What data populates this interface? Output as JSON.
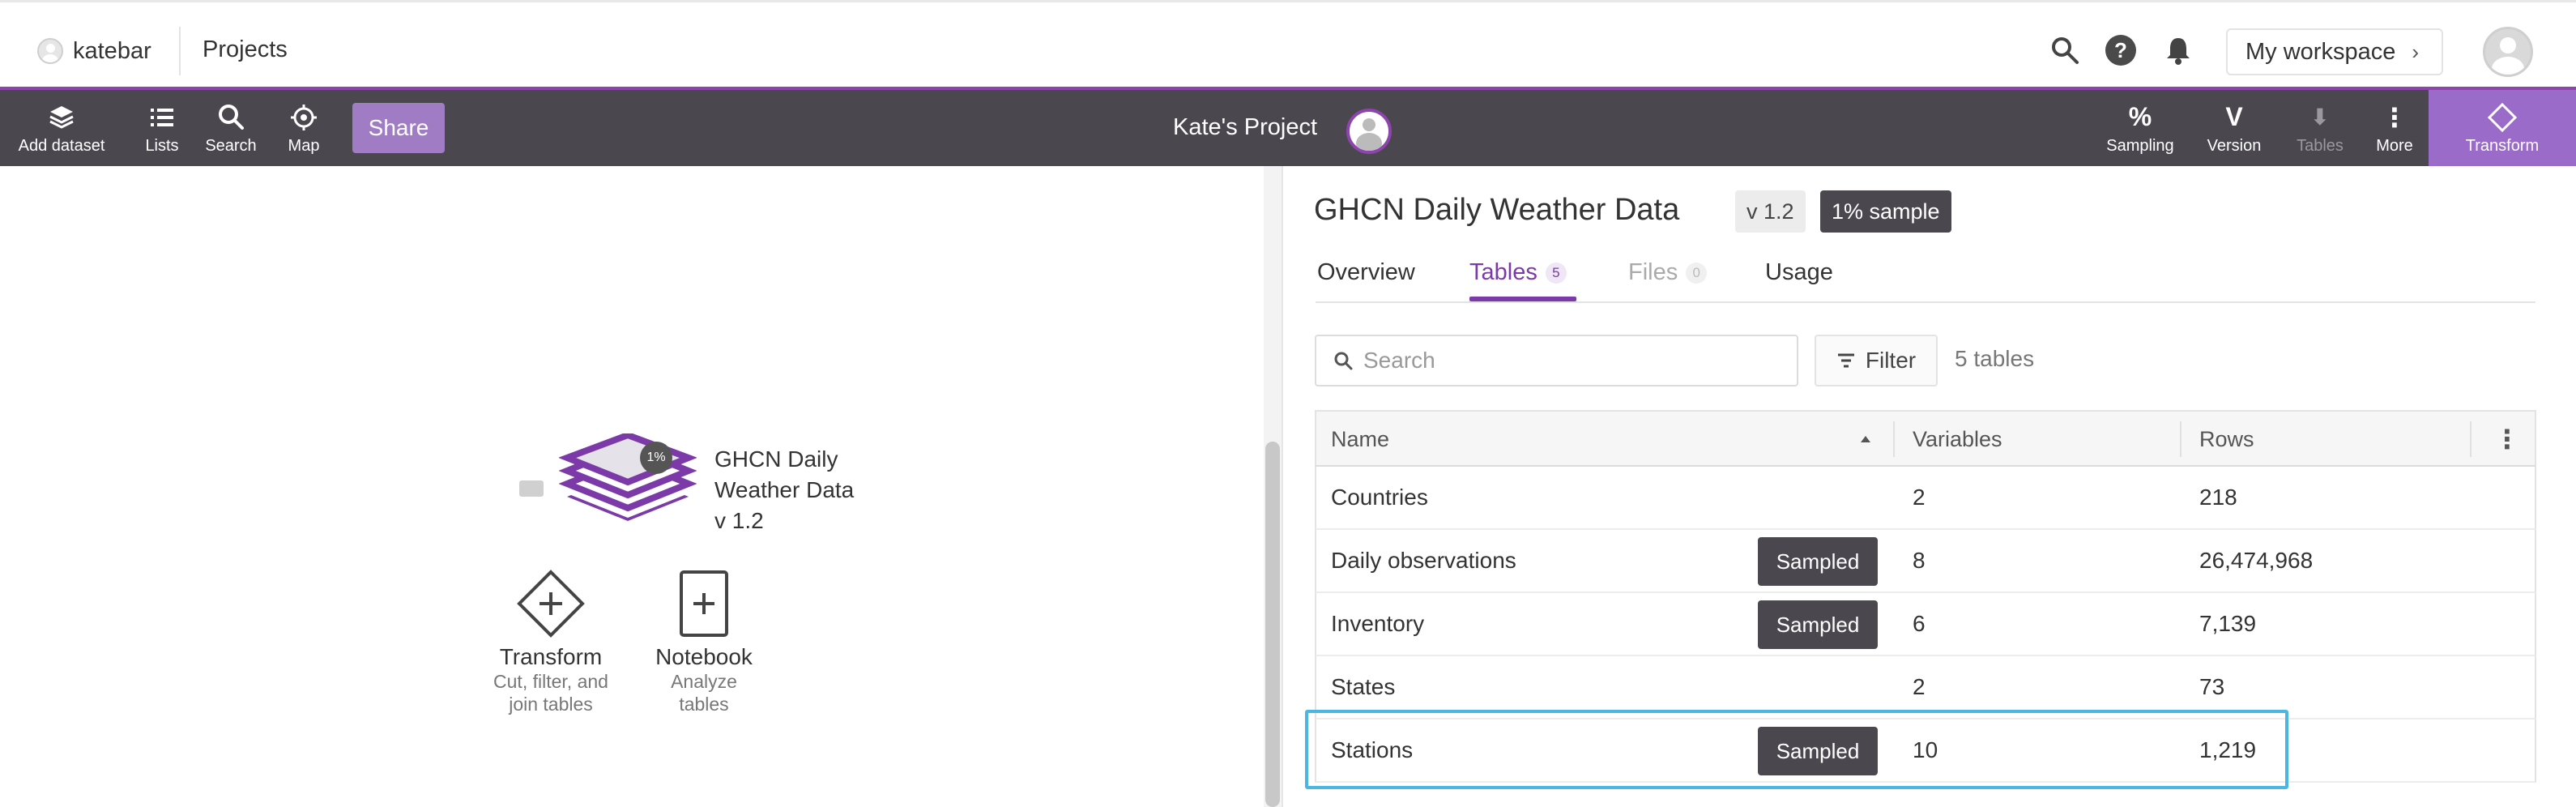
{
  "topbar": {
    "username": "katebar",
    "projects_link": "Projects",
    "workspace_button": "My workspace",
    "help_icon": "?",
    "icons": [
      "search-icon",
      "help-icon",
      "bell-icon",
      "profile-avatar"
    ]
  },
  "toolbar": {
    "left_tools": [
      {
        "label": "Add dataset",
        "icon": "layers-icon"
      },
      {
        "label": "Lists",
        "icon": "list-icon"
      },
      {
        "label": "Search",
        "icon": "search-icon"
      },
      {
        "label": "Map",
        "icon": "map-target-icon"
      }
    ],
    "share_label": "Share",
    "project_title": "Kate's Project",
    "right_tools": [
      {
        "label": "Sampling",
        "glyph": "%"
      },
      {
        "label": "Version",
        "glyph": "V"
      },
      {
        "label": "Tables",
        "glyph": "⬇"
      },
      {
        "label": "More",
        "glyph": "⋮"
      }
    ],
    "transform_label": "Transform",
    "accent_color": "#8e44ad"
  },
  "canvas": {
    "dataset_node": {
      "line1": "GHCN Daily",
      "line2": "Weather Data",
      "line3": "v 1.2",
      "badge": "1%"
    },
    "actions": [
      {
        "label": "Transform",
        "sub1": "Cut, filter, and",
        "sub2": "join tables",
        "icon": "transform-diamond-icon"
      },
      {
        "label": "Notebook",
        "sub1": "Analyze",
        "sub2": "tables",
        "icon": "notebook-icon"
      }
    ]
  },
  "dataset": {
    "title": "GHCN Daily Weather Data",
    "version_badge": "v 1.2",
    "sample_badge": "1% sample",
    "tabs": [
      {
        "label": "Overview",
        "count": ""
      },
      {
        "label": "Tables",
        "count": "5"
      },
      {
        "label": "Files",
        "count": "0"
      },
      {
        "label": "Usage",
        "count": ""
      }
    ],
    "active_tab": "Tables",
    "search_placeholder": "Search",
    "filter_label": "Filter",
    "table_count": "5 tables",
    "columns": [
      "Name",
      "Variables",
      "Rows"
    ],
    "rows": [
      {
        "name": "Countries",
        "sampled": "",
        "variables": "2",
        "rows": "218"
      },
      {
        "name": "Daily observations",
        "sampled": "Sampled",
        "variables": "8",
        "rows": "26,474,968"
      },
      {
        "name": "Inventory",
        "sampled": "Sampled",
        "variables": "6",
        "rows": "7,139"
      },
      {
        "name": "States",
        "sampled": "",
        "variables": "2",
        "rows": "73"
      },
      {
        "name": "Stations",
        "sampled": "Sampled",
        "variables": "10",
        "rows": "1,219"
      }
    ],
    "highlight_color": "#4ab7e3"
  }
}
